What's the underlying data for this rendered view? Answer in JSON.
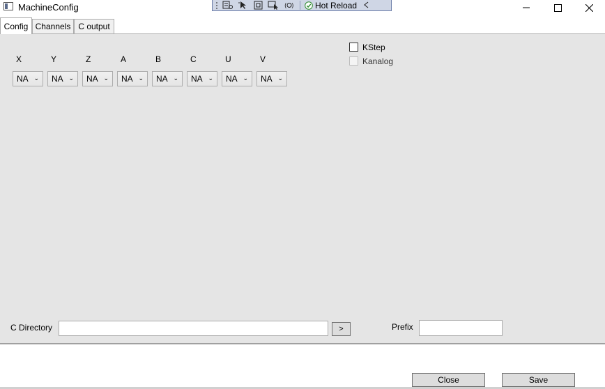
{
  "window": {
    "title": "MachineConfig",
    "icons": {
      "app": "window-app-icon",
      "minimize": "minimize-icon",
      "maximize": "maximize-icon",
      "close": "close-icon"
    }
  },
  "debug_toolbar": {
    "icons": [
      "grip-icon",
      "visual-tree-icon",
      "select-element-icon",
      "display-layout-adorners-icon",
      "track-focused-element-icon",
      "binding-failures-icon"
    ],
    "hot_reload_label": "Hot Reload",
    "hot_reload_status_icon": "checkmark-circle-icon",
    "collapse_icon": "chevron-left-icon",
    "accent": "#2e8b2e"
  },
  "tabs": [
    {
      "label": "Config",
      "active": true
    },
    {
      "label": "Channels",
      "active": false
    },
    {
      "label": "C output",
      "active": false
    }
  ],
  "axes": [
    {
      "label": "X",
      "value": "NA"
    },
    {
      "label": "Y",
      "value": "NA"
    },
    {
      "label": "Z",
      "value": "NA"
    },
    {
      "label": "A",
      "value": "NA"
    },
    {
      "label": "B",
      "value": "NA"
    },
    {
      "label": "C",
      "value": "NA"
    },
    {
      "label": "U",
      "value": "NA"
    },
    {
      "label": "V",
      "value": "NA"
    }
  ],
  "options": {
    "kstep": {
      "label": "KStep",
      "checked": false,
      "enabled": true
    },
    "kanalog": {
      "label": "Kanalog",
      "checked": false,
      "enabled": false
    }
  },
  "c_directory": {
    "label": "C Directory",
    "value": "",
    "browse_label": ">"
  },
  "prefix": {
    "label": "Prefix",
    "value": ""
  },
  "footer": {
    "close_label": "Close",
    "save_label": "Save"
  },
  "colors": {
    "panel": "#e5e5e5",
    "button": "#dddddd",
    "border": "#acacac"
  }
}
